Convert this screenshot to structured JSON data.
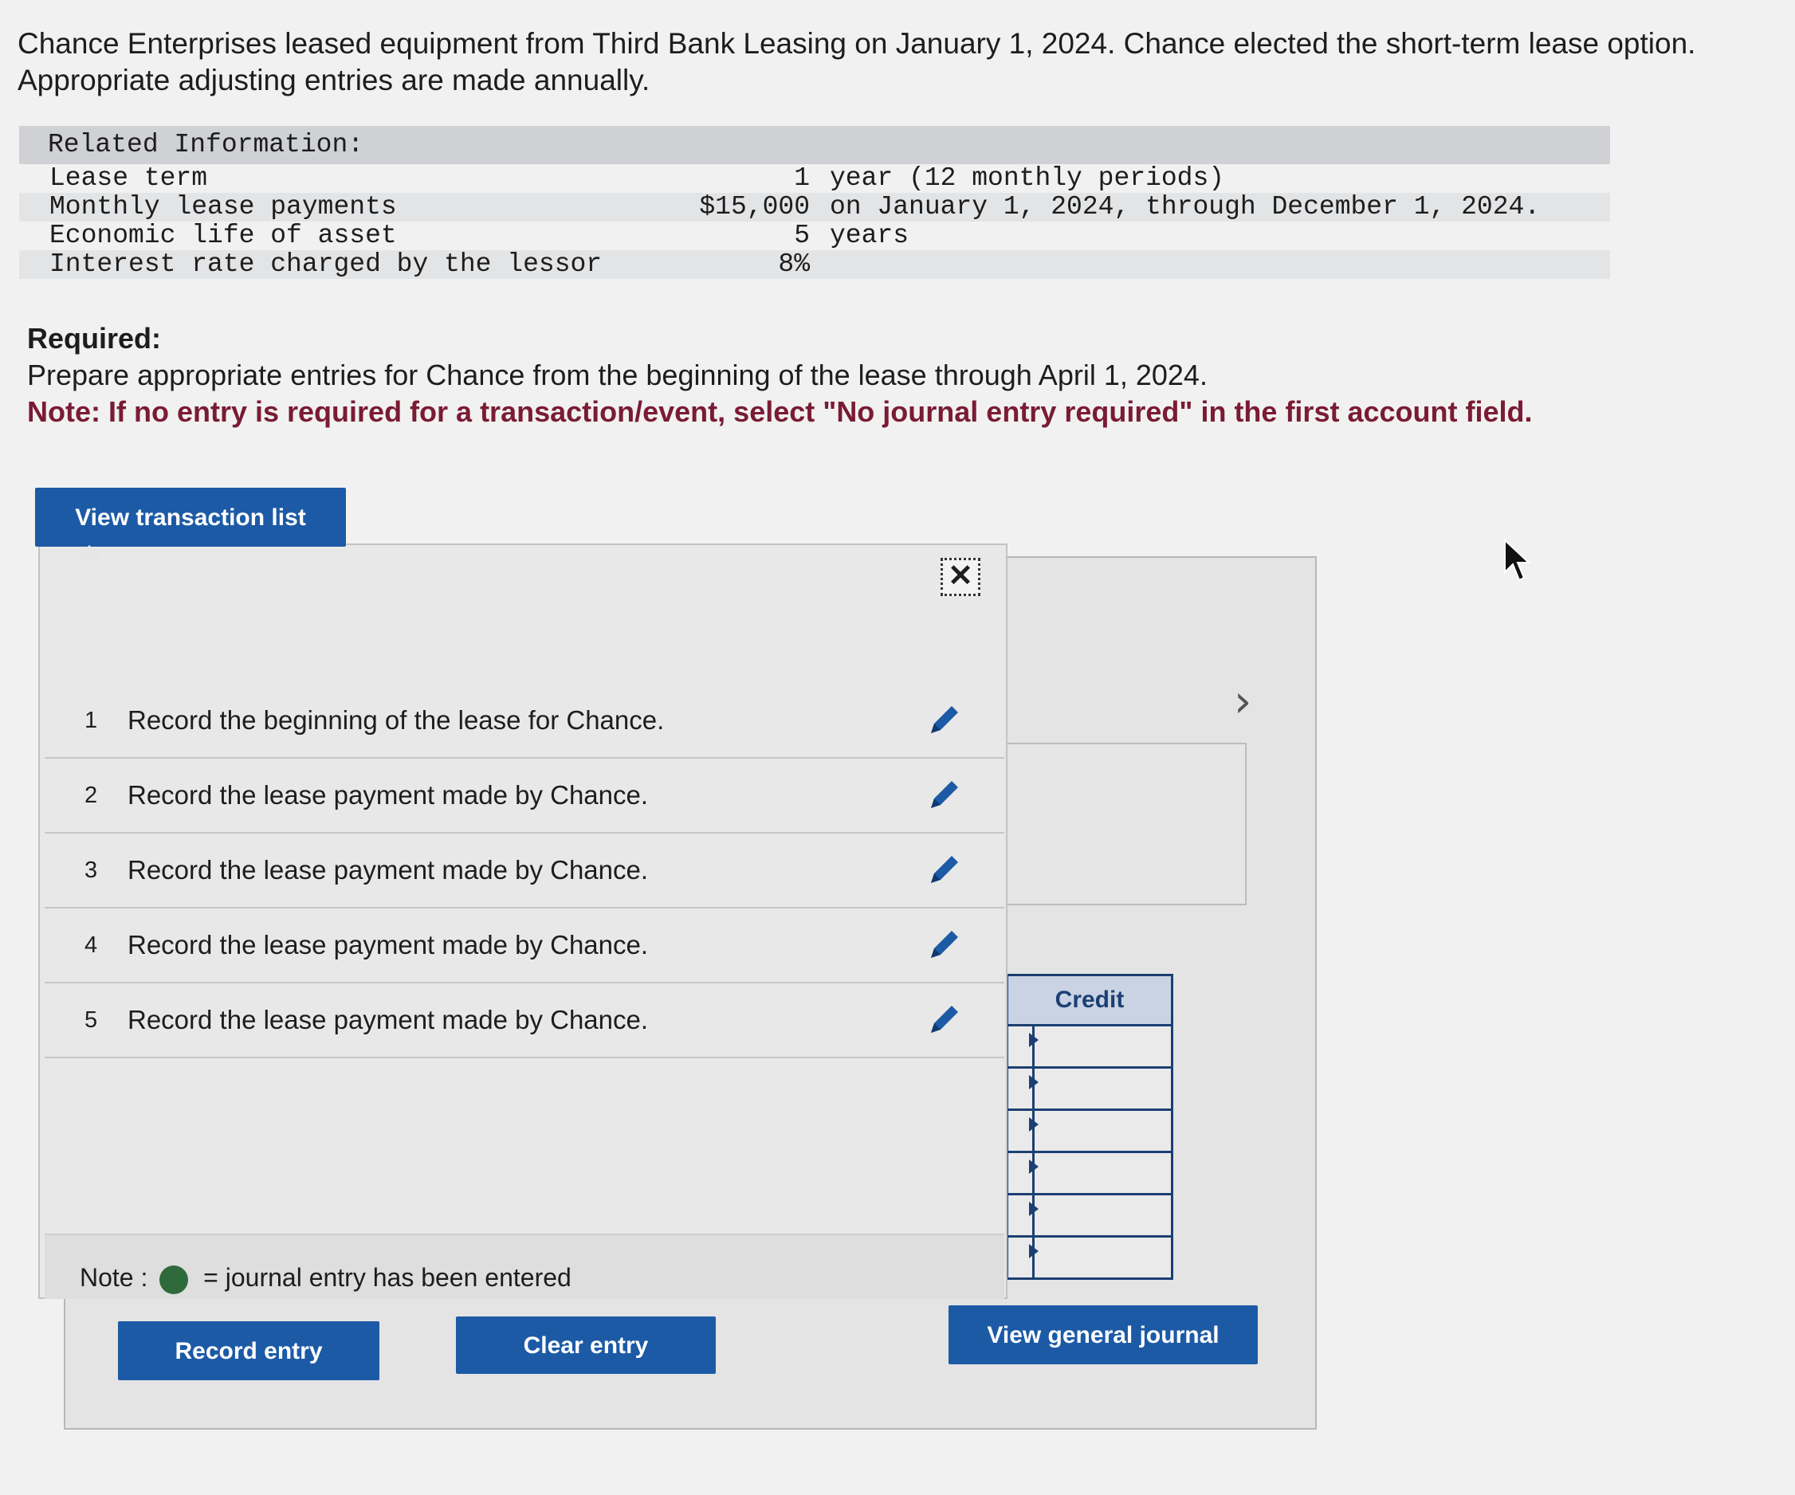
{
  "intro": {
    "line1": "Chance Enterprises leased equipment from Third Bank Leasing on January 1, 2024. Chance elected the short-term lease option.",
    "line2": "Appropriate adjusting entries are made annually."
  },
  "related_info": {
    "header": "Related Information:",
    "rows": [
      {
        "label": "Lease term",
        "value": "1",
        "detail": "year (12 monthly periods)"
      },
      {
        "label": "Monthly lease payments",
        "value": "$15,000",
        "detail": "on January 1, 2024, through December 1, 2024."
      },
      {
        "label": "Economic life of asset",
        "value": "5",
        "detail": "years"
      },
      {
        "label": "Interest rate charged by the lessor",
        "value": "8%",
        "detail": ""
      }
    ]
  },
  "required": {
    "title": "Required:",
    "text": "Prepare appropriate entries for Chance from the beginning of the lease through April 1, 2024.",
    "note": "Note: If no entry is required for a transaction/event, select \"No journal entry required\" in the first account field."
  },
  "buttons": {
    "view_transaction_list": "View transaction list",
    "record_entry": "Record entry",
    "clear_entry": "Clear entry",
    "view_general_journal": "View general journal"
  },
  "modal": {
    "close_symbol": "✕",
    "transactions": [
      {
        "num": "1",
        "text": "Record the beginning of the lease for Chance."
      },
      {
        "num": "2",
        "text": "Record the lease payment made by Chance."
      },
      {
        "num": "3",
        "text": "Record the lease payment made by Chance."
      },
      {
        "num": "4",
        "text": "Record the lease payment made by Chance."
      },
      {
        "num": "5",
        "text": "Record the lease payment made by Chance."
      }
    ],
    "note_label": "Note :",
    "note_text": "= journal entry has been entered"
  },
  "journal": {
    "credit_header": "Credit",
    "next_symbol": "›"
  },
  "colors": {
    "button_blue": "#1c5aa6",
    "note_red": "#7a1b34",
    "entered_dot": "#2f6b3a",
    "grid_navy": "#1c3f73"
  },
  "icons": [
    "pencil-icon",
    "close-icon",
    "chevron-right-icon",
    "mouse-cursor-icon"
  ]
}
